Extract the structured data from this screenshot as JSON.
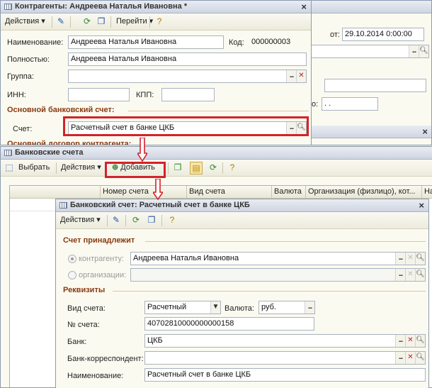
{
  "win1": {
    "title": "Контрагенты: Андреева Наталья Ивановна *",
    "actions": "Действия",
    "goto": "Перейти",
    "name_label": "Наименование:",
    "name_value": "Андреева Наталья Ивановна",
    "code_label": "Код:",
    "code_value": "000000003",
    "full_label": "Полностью:",
    "full_value": "Андреева Наталья Ивановна",
    "group_label": "Группа:",
    "inn_label": "ИНН:",
    "kpp_label": "КПП:",
    "bank_section": "Основной банковский счет:",
    "account_label": "Счет:",
    "account_value": "Расчетный счет в банке ЦКБ",
    "contract_section": "Основной договор контрагента:"
  },
  "win_bg": {
    "date_label": "от:",
    "date_value": "29.10.2014  0:00:00",
    "mini_label": "о:",
    "mini_value": ".  ."
  },
  "win2": {
    "title": "Банковские счета",
    "select": "Выбрать",
    "actions": "Действия",
    "add": "Добавить",
    "columns": [
      "Номер счета",
      "Вид счета",
      "Валюта",
      "Организация (физлицо), кот...",
      "На"
    ]
  },
  "win3": {
    "title": "Банковский счет: Расчетный счет в банке ЦКБ",
    "actions": "Действия",
    "owner_section": "Счет принадлежит",
    "radio_contractor": "контрагенту:",
    "contractor_value": "Андреева Наталья Ивановна",
    "radio_org": "организации:",
    "details_section": "Реквизиты",
    "type_label": "Вид счета:",
    "type_value": "Расчетный",
    "currency_label": "Валюта:",
    "currency_value": "руб.",
    "number_label": "№ счета:",
    "number_value": "40702810000000000158",
    "bank_label": "Банк:",
    "bank_value": "ЦКБ",
    "corr_label": "Банк-корреспондент:",
    "name_label": "Наименование:",
    "name_value": "Расчетный счет в банке ЦКБ"
  },
  "icons": [
    "pencil-icon",
    "copy-icon",
    "refresh-icon",
    "help-icon",
    "add-icon",
    "dropdown-arrow",
    "ellipsis-icon",
    "clear-icon",
    "magnifier-icon"
  ],
  "colors": {
    "highlight": "#d2232a",
    "section": "#8a3a10",
    "titlebar": "#d4dbe6",
    "panel": "#fbfaf0"
  }
}
